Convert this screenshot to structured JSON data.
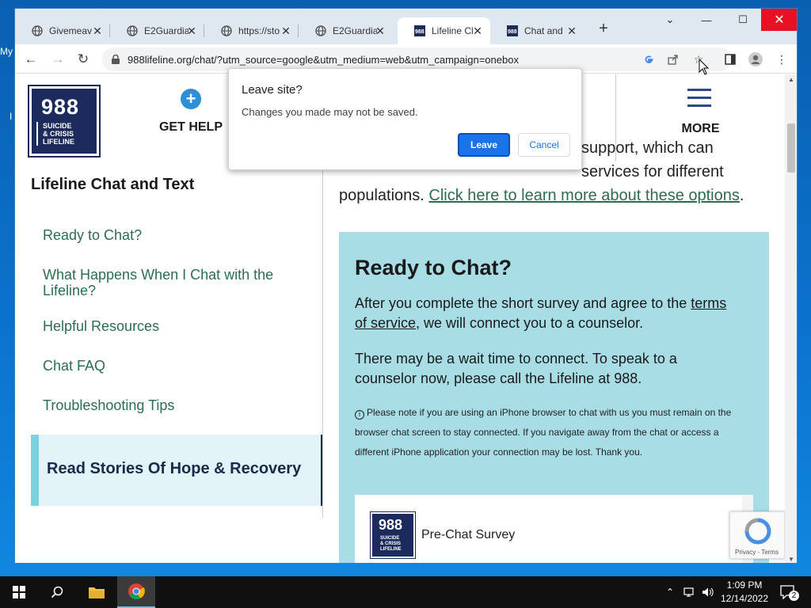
{
  "desktop": {
    "label_my": "My",
    "label_i": "I"
  },
  "browser": {
    "tabs": [
      {
        "title": "Givemeav",
        "active": false
      },
      {
        "title": "E2Guardia",
        "active": false
      },
      {
        "title": "https://sto",
        "active": false
      },
      {
        "title": "E2Guardia",
        "active": false
      },
      {
        "title": "Lifeline Cl",
        "active": true
      },
      {
        "title": "Chat and",
        "active": false
      }
    ],
    "new_tab": "+",
    "url": "988lifeline.org/chat/?utm_source=google&utm_medium=web&utm_campaign=onebox"
  },
  "site": {
    "logo": {
      "number": "988",
      "line1": "SUICIDE",
      "line2": "& CRISIS",
      "line3": "LIFELINE"
    },
    "get_help": "GET HELP",
    "more": "MORE",
    "sidebar": {
      "title": "Lifeline Chat and Text",
      "items": [
        "Ready to Chat?",
        "What Happens When I Chat with the Lifeline?",
        "Helpful Resources",
        "Chat FAQ",
        "Troubleshooting Tips"
      ],
      "stories": "Read Stories Of Hope & Recovery"
    },
    "intro": {
      "line1": "support, which can",
      "line2": "services for different",
      "line3_pre": "populations. ",
      "line3_link": "Click here to learn more about these options",
      "line3_post": "."
    },
    "chat": {
      "title": "Ready to Chat?",
      "p1_pre": "After you complete the short survey and agree to the ",
      "p1_link_a": "terms",
      "p1_link_b": "of service",
      "p1_post": ", we will connect you to a counselor.",
      "p2_line1": "There may be a wait time to connect. To speak to a",
      "p2_line2": "counselor now, please call the Lifeline at 988.",
      "note_line1": "Please note if you are using an iPhone browser to chat with us you must remain on the",
      "note_line2": "browser chat screen to stay connected. If you navigate away from the chat or access a",
      "note_line3": "different iPhone application your connection may be lost. Thank you.",
      "survey_title": "Pre-Chat Survey"
    },
    "recaptcha": "Privacy - Terms"
  },
  "dialog": {
    "title": "Leave site?",
    "message": "Changes you made may not be saved.",
    "leave": "Leave",
    "cancel": "Cancel"
  },
  "taskbar": {
    "time": "1:09 PM",
    "date": "12/14/2022",
    "notifications": "2"
  },
  "colors": {
    "accent": "#1a73e8",
    "brand_navy": "#1c2b5c",
    "link_green": "#2b6e4f",
    "chat_bg": "#a8dde6"
  }
}
